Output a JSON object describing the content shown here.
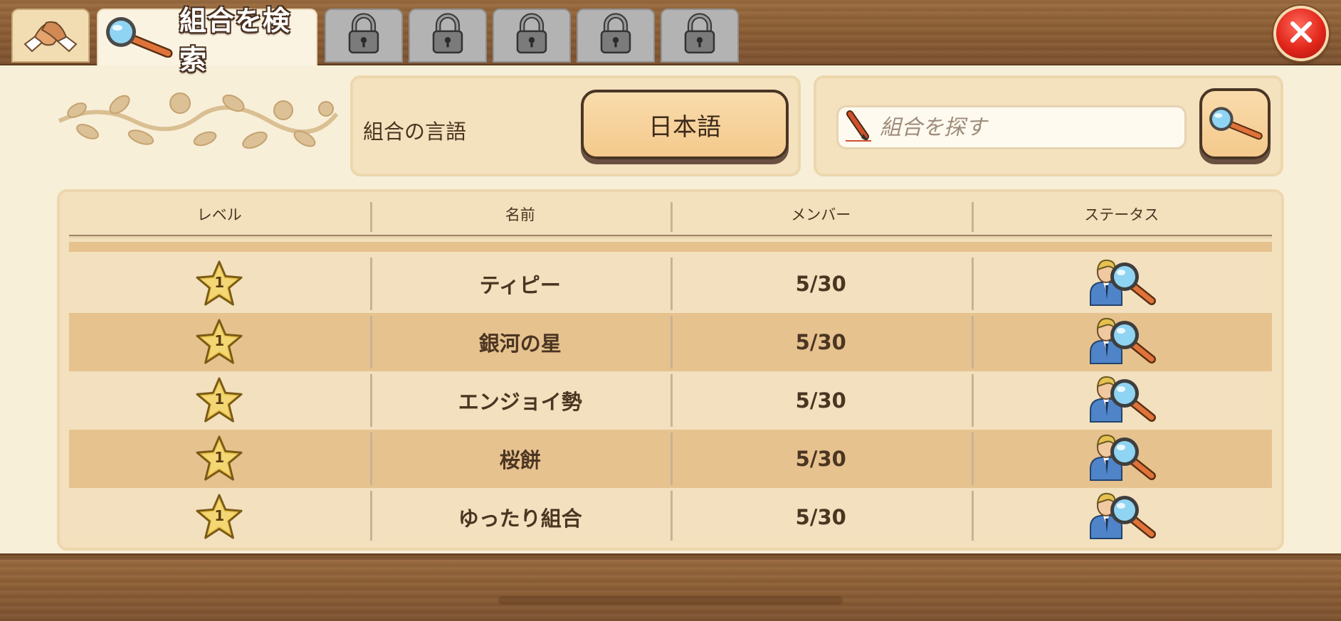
{
  "tabs": {
    "home_icon": "handshake-icon",
    "active_label": "組合を検索",
    "active_icon": "magnifier-icon",
    "locked_icon": "padlock-icon",
    "locked_count": 5
  },
  "close_icon": "close-icon",
  "language": {
    "label": "組合の言語",
    "value": "日本語"
  },
  "search": {
    "placeholder": "組合を探す",
    "value": "",
    "field_icon": "pencil-icon",
    "button_icon": "magnifier-icon"
  },
  "table": {
    "headers": [
      "レベル",
      "名前",
      "メンバー",
      "ステータス"
    ],
    "rows": [
      {
        "level": "1",
        "name": "ティピー",
        "members": "5/30",
        "status_icon": "user-search-icon"
      },
      {
        "level": "1",
        "name": "銀河の星",
        "members": "5/30",
        "status_icon": "user-search-icon"
      },
      {
        "level": "1",
        "name": "エンジョイ勢",
        "members": "5/30",
        "status_icon": "user-search-icon"
      },
      {
        "level": "1",
        "name": "桜餅",
        "members": "5/30",
        "status_icon": "user-search-icon"
      },
      {
        "level": "1",
        "name": "ゆったり組合",
        "members": "5/30",
        "status_icon": "user-search-icon"
      }
    ]
  },
  "colors": {
    "row_odd": "#f2e0be",
    "row_even": "#e6c28f",
    "button": "#f4c98c",
    "close_red": "#e2261b"
  }
}
